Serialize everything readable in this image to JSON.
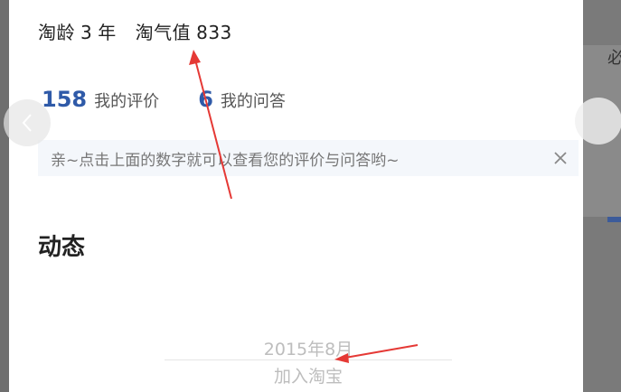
{
  "profile": {
    "taobao_age_label": "淘龄",
    "taobao_age_value": "3",
    "taobao_age_unit": "年",
    "taoqi_label": "淘气值",
    "taoqi_value": "833"
  },
  "stats": [
    {
      "count": "158",
      "label": "我的评价"
    },
    {
      "count": "6",
      "label": "我的问答"
    }
  ],
  "tip": {
    "text": "亲~点击上面的数字就可以查看您的评价与问答哟~"
  },
  "section": {
    "title": "动态"
  },
  "timeline": {
    "date": "2015年8月",
    "event": "加入淘宝"
  },
  "icons": {
    "close": "close-icon",
    "prev": "chevron-left-icon"
  },
  "colors": {
    "accent": "#2f5aa8",
    "annotation": "#e53935",
    "tip_bg": "#f4f7fb"
  }
}
